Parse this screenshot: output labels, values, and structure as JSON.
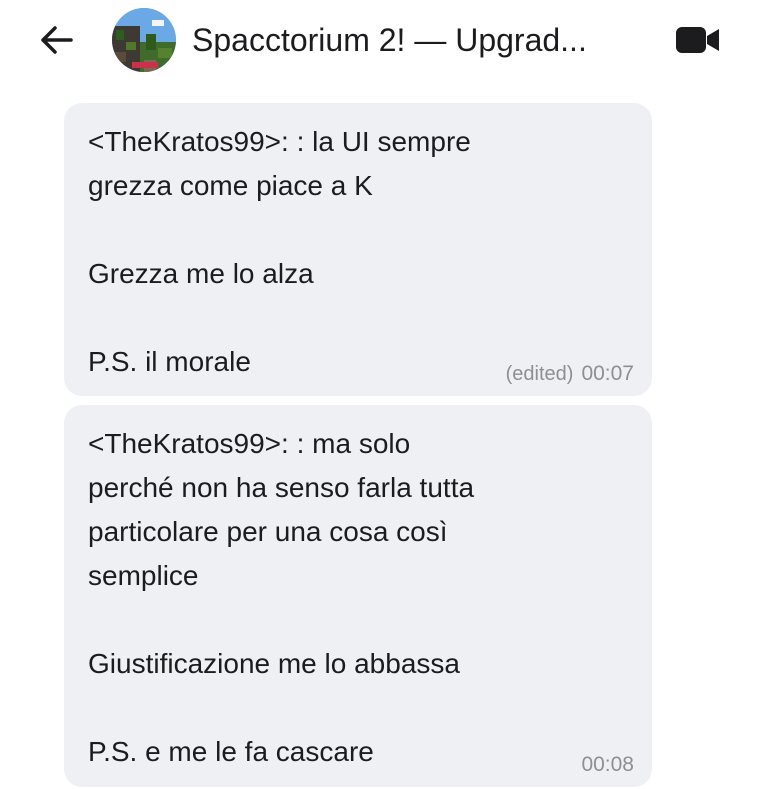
{
  "header": {
    "title": "Spacctorium 2! — Upgrad...",
    "back_icon": "arrow-left-icon",
    "video_icon": "video-camera-icon"
  },
  "messages": [
    {
      "lines": [
        "<TheKratos99>: : la UI sempre",
        "grezza come piace a K",
        "",
        "Grezza me lo alza",
        "",
        "P.S. il morale"
      ],
      "edited": "(edited)",
      "time": "00:07"
    },
    {
      "lines": [
        "<TheKratos99>: : ma solo",
        "perché non ha senso farla tutta",
        "particolare per una cosa così",
        "semplice",
        "",
        "Giustificazione me lo abbassa",
        "",
        "P.S. e me le fa cascare"
      ],
      "time": "00:08"
    }
  ]
}
